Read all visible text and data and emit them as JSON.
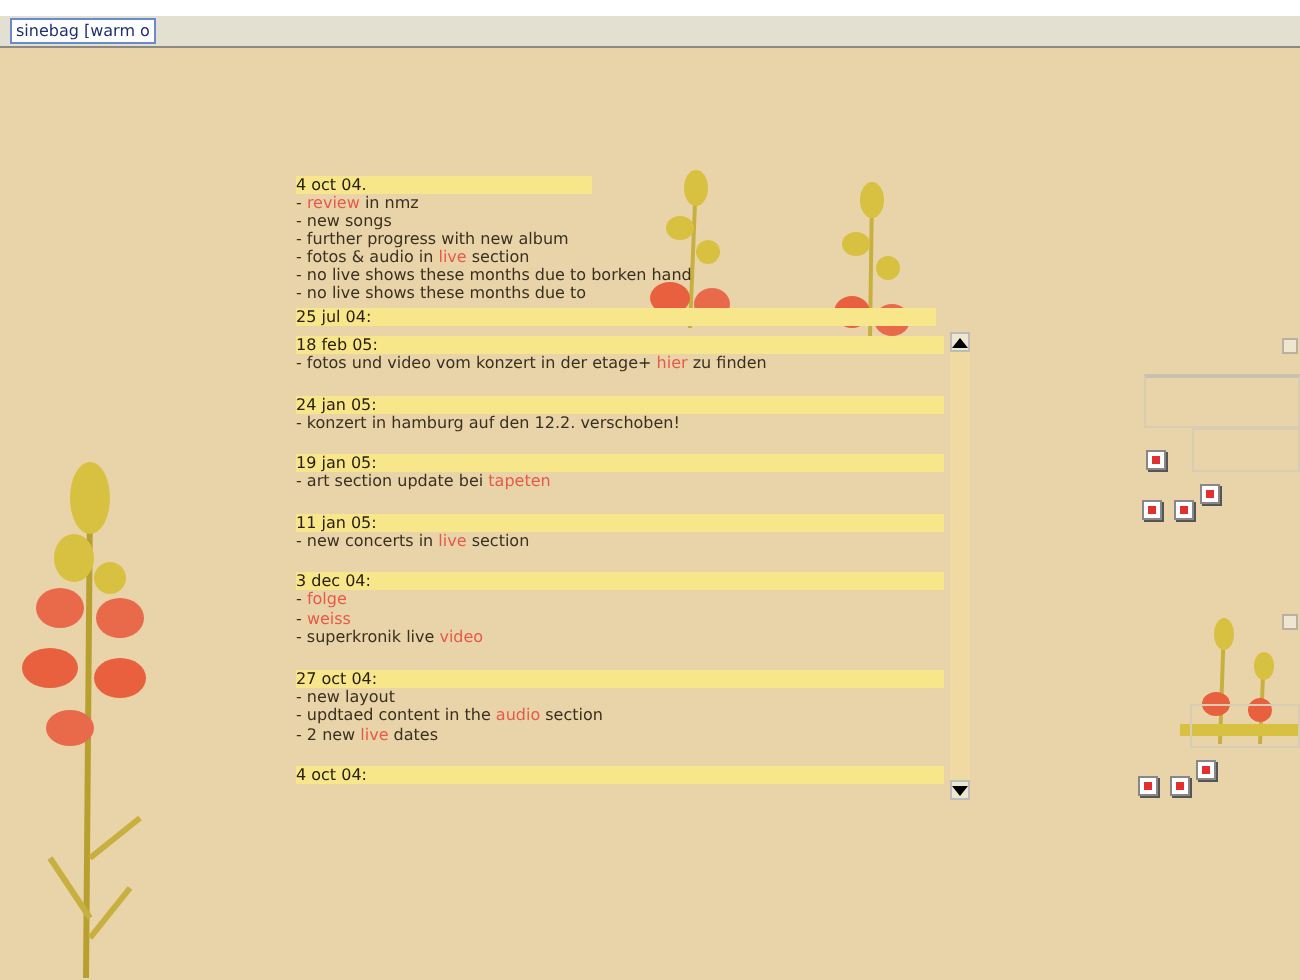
{
  "tab": {
    "title": "sinebag [warm o",
    "selected": true
  },
  "header_news": {
    "date": "4 oct 04.",
    "lines": [
      [
        {
          "kind": "text",
          "text": "- "
        },
        {
          "kind": "link",
          "text": "review"
        },
        {
          "kind": "text",
          "text": " in nmz"
        }
      ],
      [
        {
          "kind": "text",
          "text": "- new songs"
        }
      ],
      [
        {
          "kind": "text",
          "text": "- further progress with new album"
        }
      ],
      [
        {
          "kind": "text",
          "text": "- fotos & audio in "
        },
        {
          "kind": "link",
          "text": "live"
        },
        {
          "kind": "text",
          "text": " section"
        }
      ],
      [
        {
          "kind": "text",
          "text": "- no live shows these months due to borken hand"
        }
      ],
      [
        {
          "kind": "text",
          "text": "- no live shows these months due to"
        }
      ]
    ],
    "next_date": "25 jul 04:"
  },
  "news": [
    {
      "date": "18 feb 05:",
      "lines": [
        [
          {
            "kind": "text",
            "text": "- fotos und video vom konzert in der etage+ "
          },
          {
            "kind": "link",
            "text": "hier"
          },
          {
            "kind": "text",
            "text": " zu finden"
          }
        ]
      ]
    },
    {
      "date": "24 jan 05:",
      "lines": [
        [
          {
            "kind": "text",
            "text": "- konzert in hamburg auf den 12.2. verschoben!"
          }
        ]
      ]
    },
    {
      "date": "19 jan 05:",
      "lines": [
        [
          {
            "kind": "text",
            "text": "- art section update bei "
          },
          {
            "kind": "link",
            "text": "tapeten"
          }
        ]
      ]
    },
    {
      "date": "11 jan 05:",
      "lines": [
        [
          {
            "kind": "text",
            "text": "- new concerts in "
          },
          {
            "kind": "link",
            "text": "live"
          },
          {
            "kind": "text",
            "text": " section"
          }
        ]
      ]
    },
    {
      "date": "3 dec 04:",
      "lines": [
        [
          {
            "kind": "text",
            "text": "- "
          },
          {
            "kind": "link",
            "text": "folge"
          }
        ],
        [
          {
            "kind": "text",
            "text": "- "
          },
          {
            "kind": "link",
            "text": "weiss"
          }
        ],
        [
          {
            "kind": "text",
            "text": "- superkronik live "
          },
          {
            "kind": "link",
            "text": "video"
          }
        ]
      ]
    },
    {
      "date": "27 oct 04:",
      "lines": [
        [
          {
            "kind": "text",
            "text": "- new layout"
          }
        ],
        [
          {
            "kind": "text",
            "text": "- updtaed content in the "
          },
          {
            "kind": "link",
            "text": "audio"
          },
          {
            "kind": "text",
            "text": " section"
          }
        ],
        [
          {
            "kind": "text",
            "text": "- 2 new "
          },
          {
            "kind": "link",
            "text": "live"
          },
          {
            "kind": "text",
            "text": " dates"
          }
        ]
      ]
    },
    {
      "date": "4 oct 04:"
    }
  ]
}
